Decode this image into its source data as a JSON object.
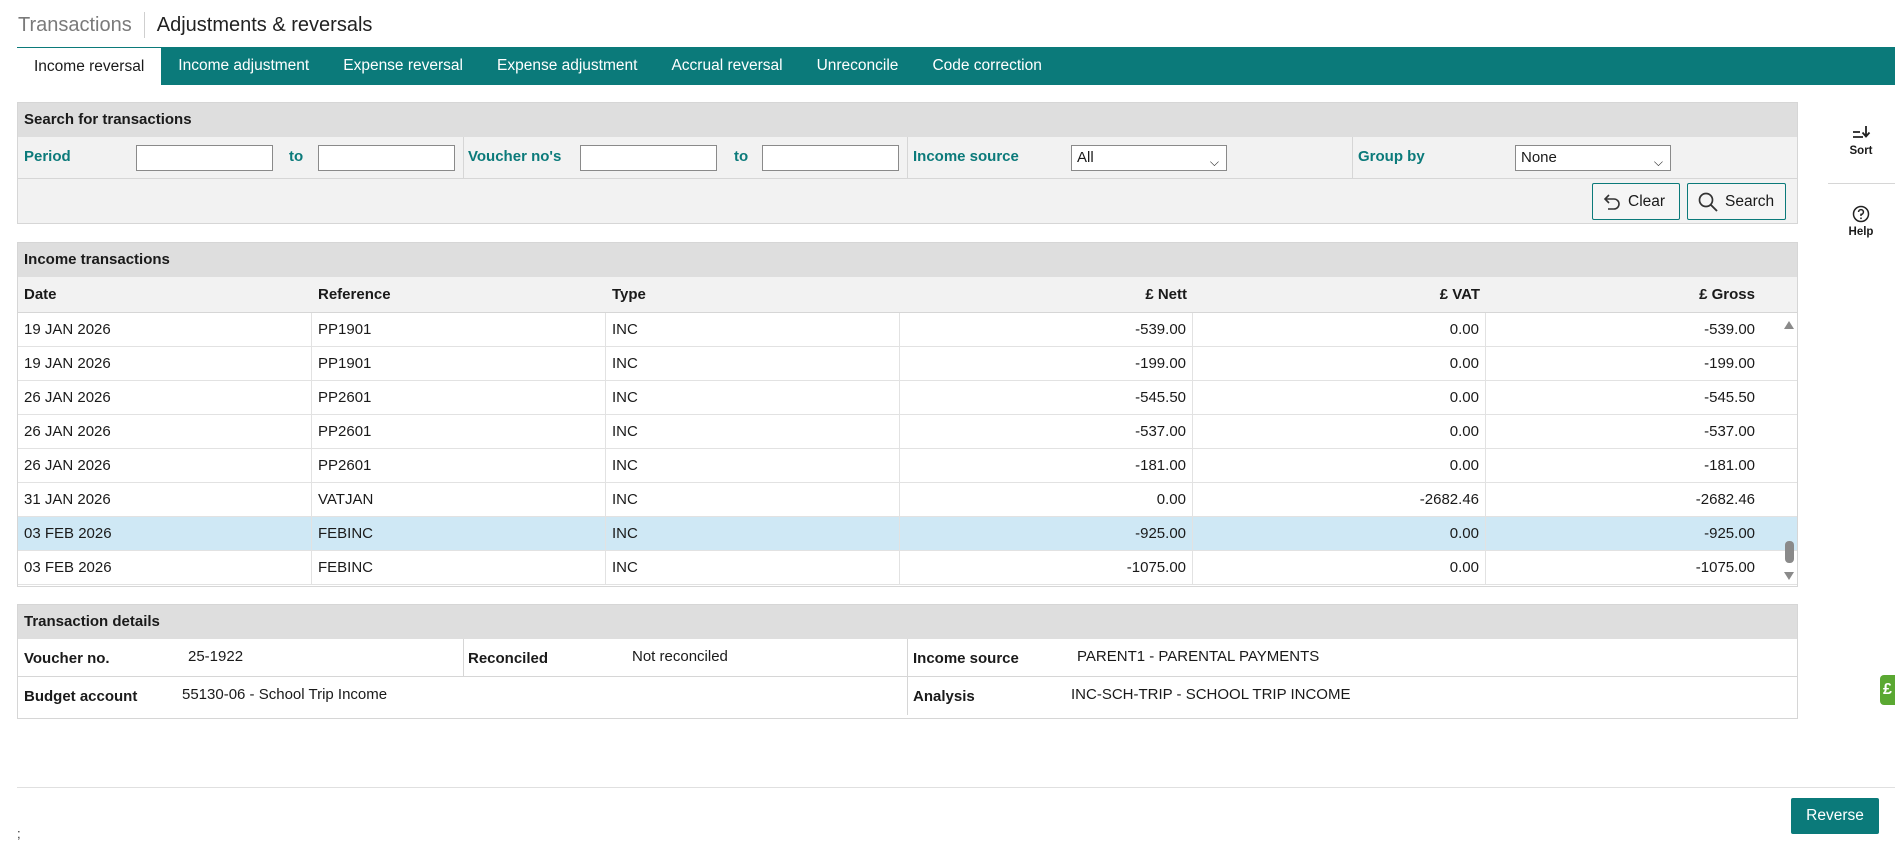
{
  "header": {
    "section": "Transactions",
    "title": "Adjustments & reversals"
  },
  "tabs": [
    {
      "label": "Income reversal",
      "active": true
    },
    {
      "label": "Income adjustment"
    },
    {
      "label": "Expense reversal"
    },
    {
      "label": "Expense adjustment"
    },
    {
      "label": "Accrual reversal"
    },
    {
      "label": "Unreconcile"
    },
    {
      "label": "Code correction"
    }
  ],
  "search": {
    "title": "Search for transactions",
    "period_label": "Period",
    "to_label": "to",
    "period_from": "",
    "period_to": "",
    "voucher_label": "Voucher no's",
    "voucher_from": "",
    "voucher_to": "",
    "income_source_label": "Income source",
    "income_source_value": "All",
    "group_by_label": "Group by",
    "group_by_value": "None",
    "clear_label": "Clear",
    "search_label": "Search"
  },
  "transactions": {
    "title": "Income transactions",
    "columns": [
      "Date",
      "Reference",
      "Type",
      "£ Nett",
      "£ VAT",
      "£ Gross"
    ],
    "rows": [
      {
        "date": "19 JAN 2026",
        "reference": "PP1901",
        "type": "INC",
        "nett": "-539.00",
        "vat": "0.00",
        "gross": "-539.00"
      },
      {
        "date": "19 JAN 2026",
        "reference": "PP1901",
        "type": "INC",
        "nett": "-199.00",
        "vat": "0.00",
        "gross": "-199.00"
      },
      {
        "date": "26 JAN 2026",
        "reference": "PP2601",
        "type": "INC",
        "nett": "-545.50",
        "vat": "0.00",
        "gross": "-545.50"
      },
      {
        "date": "26 JAN 2026",
        "reference": "PP2601",
        "type": "INC",
        "nett": "-537.00",
        "vat": "0.00",
        "gross": "-537.00"
      },
      {
        "date": "26 JAN 2026",
        "reference": "PP2601",
        "type": "INC",
        "nett": "-181.00",
        "vat": "0.00",
        "gross": "-181.00"
      },
      {
        "date": "31 JAN 2026",
        "reference": "VATJAN",
        "type": "INC",
        "nett": "0.00",
        "vat": "-2682.46",
        "gross": "-2682.46"
      },
      {
        "date": "03 FEB 2026",
        "reference": "FEBINC",
        "type": "INC",
        "nett": "-925.00",
        "vat": "0.00",
        "gross": "-925.00",
        "selected": true
      },
      {
        "date": "03 FEB 2026",
        "reference": "FEBINC",
        "type": "INC",
        "nett": "-1075.00",
        "vat": "0.00",
        "gross": "-1075.00"
      }
    ]
  },
  "details": {
    "title": "Transaction details",
    "voucher_label": "Voucher no.",
    "voucher_value": "25-1922",
    "reconciled_label": "Reconciled",
    "reconciled_value": "Not reconciled",
    "income_source_label": "Income source",
    "income_source_value": "PARENT1 - PARENTAL PAYMENTS",
    "budget_label": "Budget account",
    "budget_value": "55130-06 - School Trip Income",
    "analysis_label": "Analysis",
    "analysis_value": "INC-SCH-TRIP - SCHOOL TRIP INCOME"
  },
  "rail": {
    "sort_label": "Sort",
    "help_label": "Help",
    "side_tab_label": "£"
  },
  "footer": {
    "reverse_label": "Reverse",
    "stray_text": ";"
  },
  "colors": {
    "teal": "#0b7a7a",
    "selected_row": "#cfe8f5",
    "side_tab_green": "#5aa832"
  }
}
